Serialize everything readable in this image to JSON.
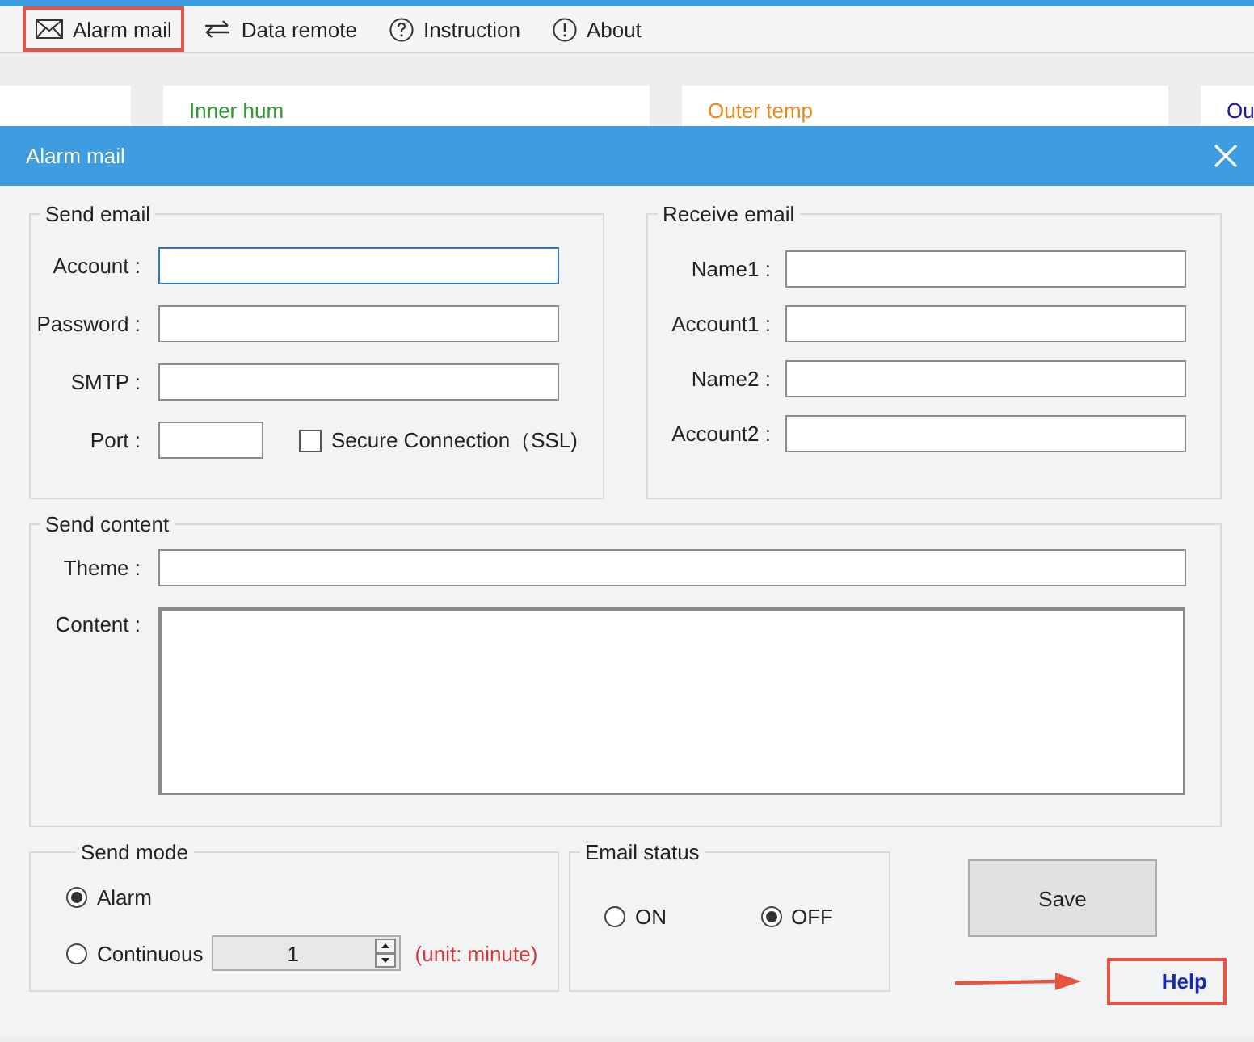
{
  "toolbar": {
    "items": [
      {
        "label": "Alarm mail",
        "kind": "mail",
        "highlighted": true
      },
      {
        "label": "Data remote",
        "kind": "transfer",
        "highlighted": false
      },
      {
        "label": "Instruction",
        "kind": "question",
        "highlighted": false
      },
      {
        "label": "About",
        "kind": "info",
        "highlighted": false
      }
    ]
  },
  "cards": [
    {
      "label": "Inner hum",
      "color": "#2e9a2e"
    },
    {
      "label": "Outer temp",
      "color": "#e8891c"
    },
    {
      "label": "Ou",
      "color": "#1c1ca0"
    }
  ],
  "dialog": {
    "title": "Alarm mail",
    "send_email": {
      "legend": "Send email",
      "fields": [
        {
          "label": "Account :",
          "focused": true
        },
        {
          "label": "Password :",
          "focused": false
        },
        {
          "label": "SMTP :",
          "focused": false
        }
      ],
      "port_label": "Port :",
      "ssl": {
        "label": "Secure Connection（SSL)",
        "checked": false
      }
    },
    "receive_email": {
      "legend": "Receive email",
      "fields": [
        {
          "label": "Name1 :"
        },
        {
          "label": "Account1 :"
        },
        {
          "label": "Name2 :"
        },
        {
          "label": "Account2 :"
        }
      ]
    },
    "send_content": {
      "legend": "Send content",
      "theme_label": "Theme :",
      "content_label": "Content :"
    },
    "send_mode": {
      "legend": "Send mode",
      "options": [
        {
          "label": "Alarm",
          "selected": true
        },
        {
          "label": "Continuous",
          "selected": false
        }
      ],
      "interval": "1",
      "unit": "(unit: minute)"
    },
    "email_status": {
      "legend": "Email status",
      "options": [
        {
          "label": "ON",
          "selected": false
        },
        {
          "label": "OFF",
          "selected": true
        }
      ]
    },
    "save": "Save",
    "help": {
      "label": "Help",
      "highlighted": true
    }
  }
}
